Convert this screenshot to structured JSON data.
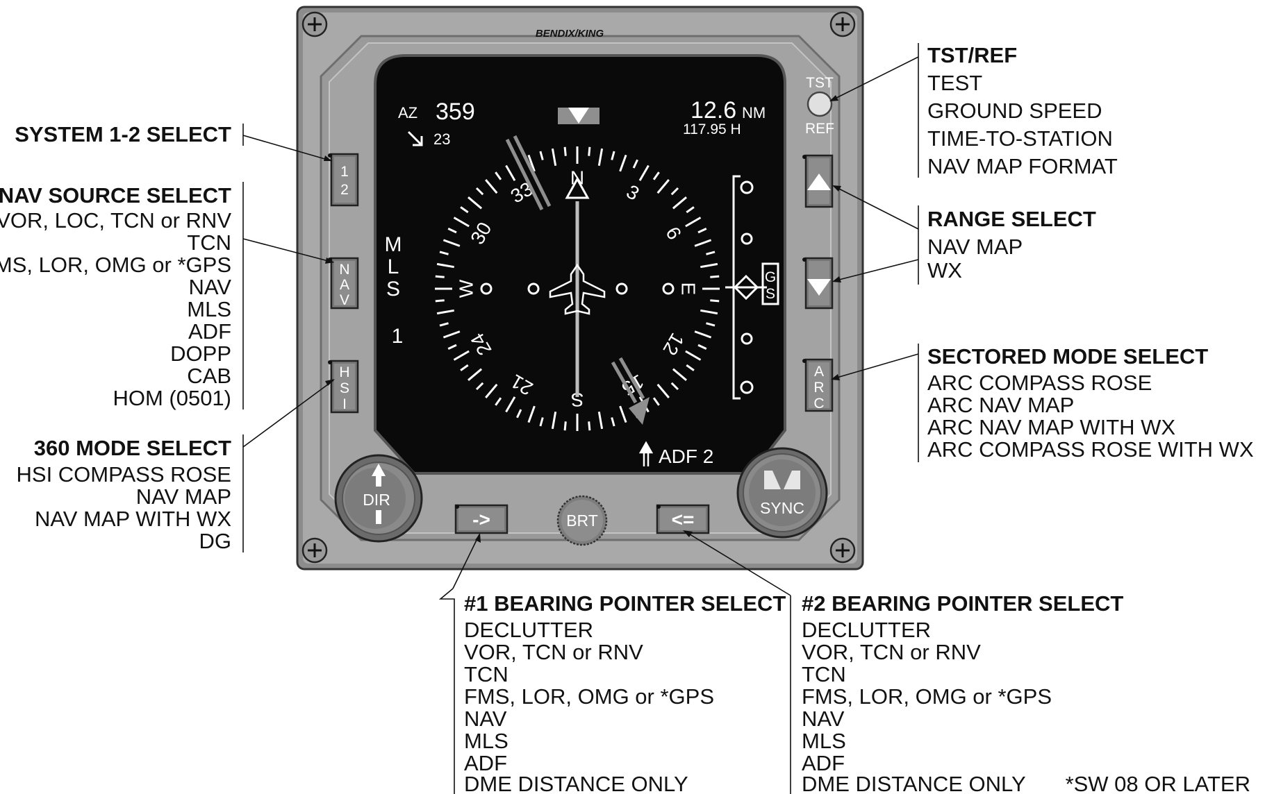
{
  "instrument": {
    "brand": "BENDIX/KING",
    "buttons": {
      "system": "1\n2",
      "nav": "N\nA\nV",
      "hsi": "H\nS\nI",
      "arc": "A\nR\nC",
      "bearing1": "->",
      "bearing2": "<=",
      "tst_label": "TST",
      "ref_label": "REF"
    },
    "knobs": {
      "dir": "DIR",
      "brt": "BRT",
      "sync": "SYNC"
    },
    "display": {
      "az_label": "AZ",
      "az_value": "359",
      "wind_value": "23",
      "distance": "12.6",
      "distance_unit": "NM",
      "frequency": "117.95 H",
      "source_letters": [
        "M",
        "L",
        "S"
      ],
      "source_num": "1",
      "gs_letters": [
        "G",
        "S"
      ],
      "adf_label": "ADF 2",
      "compass_labels": [
        "N",
        "3",
        "6",
        "E",
        "12",
        "15",
        "S",
        "21",
        "24",
        "W",
        "30",
        "33"
      ]
    }
  },
  "callouts": {
    "system_select": {
      "title": "SYSTEM 1-2 SELECT",
      "items": []
    },
    "nav_source_select": {
      "title": "NAV SOURCE SELECT",
      "items": [
        "VOR, LOC, TCN or RNV",
        "TCN",
        "FMS, LOR, OMG or *GPS",
        "NAV",
        "MLS",
        "ADF",
        "DOPP",
        "CAB",
        "HOM (0501)"
      ]
    },
    "mode_360_select": {
      "title": "360 MODE SELECT",
      "items": [
        "HSI COMPASS ROSE",
        "NAV MAP",
        "NAV MAP WITH WX",
        "DG"
      ]
    },
    "tst_ref": {
      "title": "TST/REF",
      "items": [
        "TEST",
        "GROUND SPEED",
        "TIME-TO-STATION",
        "NAV MAP FORMAT"
      ]
    },
    "range_select": {
      "title": "RANGE SELECT",
      "items": [
        "NAV MAP",
        "WX"
      ]
    },
    "sectored_mode_select": {
      "title": "SECTORED MODE SELECT",
      "items": [
        "ARC COMPASS ROSE",
        "ARC NAV MAP",
        "ARC NAV MAP WITH WX",
        "ARC COMPASS ROSE WITH WX"
      ]
    },
    "bearing_1_select": {
      "title": "#1 BEARING POINTER SELECT",
      "items": [
        "DECLUTTER",
        "VOR, TCN or RNV",
        "TCN",
        "FMS, LOR, OMG or *GPS",
        "NAV",
        "MLS",
        "ADF",
        "DME DISTANCE ONLY"
      ]
    },
    "bearing_2_select": {
      "title": "#2 BEARING POINTER SELECT",
      "items": [
        "DECLUTTER",
        "VOR, TCN or RNV",
        "TCN",
        "FMS, LOR, OMG or *GPS",
        "NAV",
        "MLS",
        "ADF",
        "DME DISTANCE ONLY"
      ]
    }
  },
  "footnote": "*SW 08 OR LATER",
  "colors": {
    "bezel": "#a6a6a6",
    "bezel_dark": "#7d7d7d",
    "screen": "#0a0a0a",
    "pointer": "#8f8f8f"
  }
}
